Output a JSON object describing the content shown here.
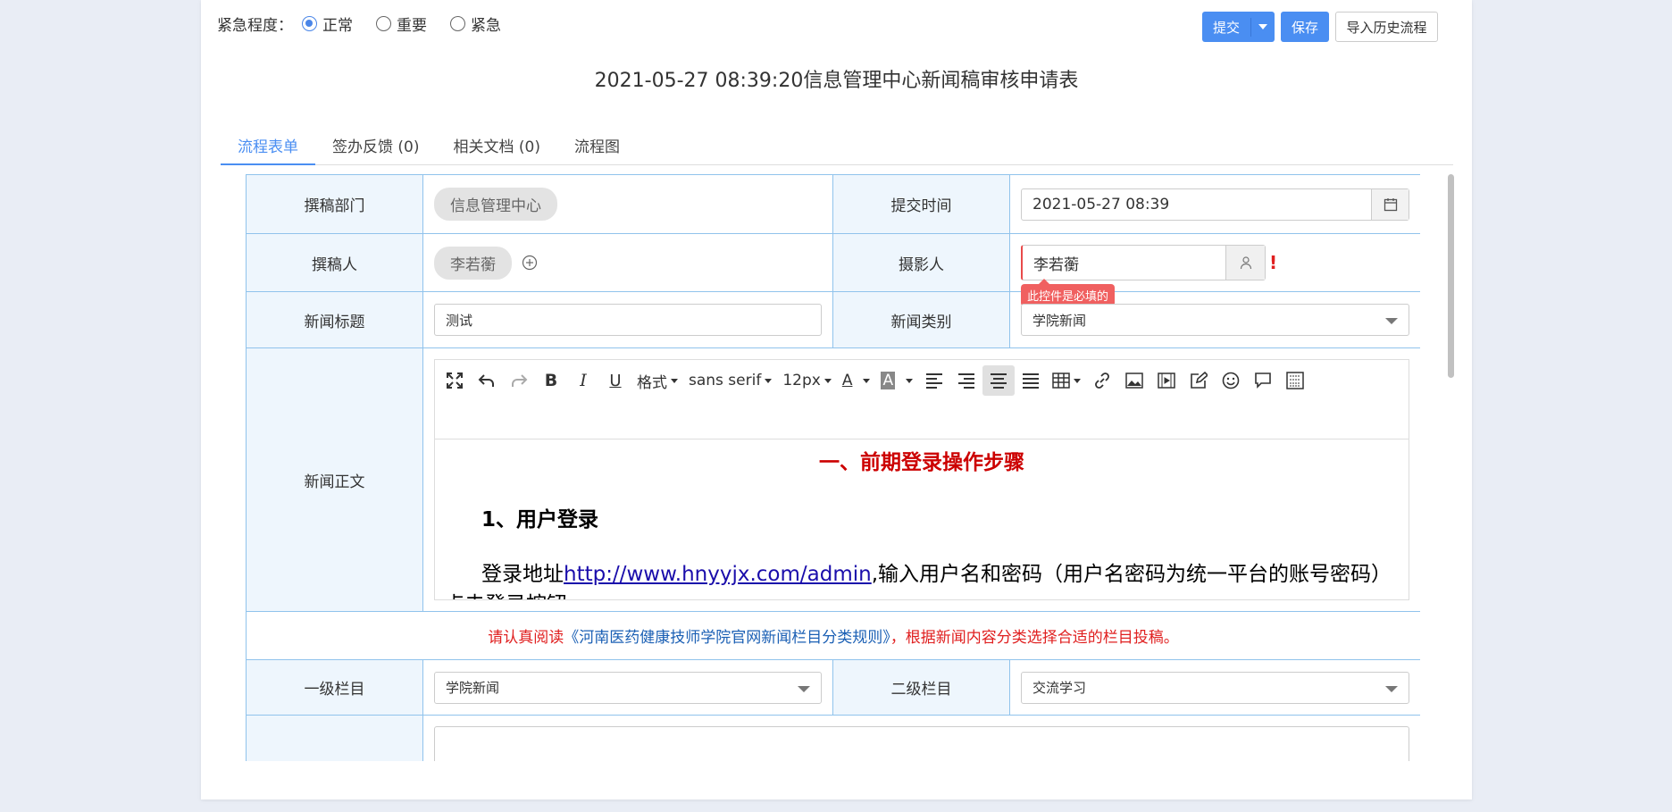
{
  "urgency": {
    "label": "紧急程度：",
    "options": [
      "正常",
      "重要",
      "紧急"
    ],
    "selected": "正常"
  },
  "buttons": {
    "submit": "提交",
    "save": "保存",
    "import": "导入历史流程"
  },
  "title": "2021-05-27 08:39:20信息管理中心新闻稿审核申请表",
  "tabs": [
    "流程表单",
    "签办反馈 (0)",
    "相关文档 (0)",
    "流程图"
  ],
  "form": {
    "dept_label": "撰稿部门",
    "dept_value": "信息管理中心",
    "submit_time_label": "提交时间",
    "submit_time_value": "2021-05-27 08:39",
    "author_label": "撰稿人",
    "author_value": "李若蘅",
    "photographer_label": "摄影人",
    "photographer_value": "李若蘅",
    "required_tip": "此控件是必填的",
    "news_title_label": "新闻标题",
    "news_title_value": "测试",
    "news_type_label": "新闻类别",
    "news_type_value": "学院新闻",
    "body_label": "新闻正文",
    "level1_label": "一级栏目",
    "level1_value": "学院新闻",
    "level2_label": "二级栏目",
    "level2_value": "交流学习"
  },
  "editor": {
    "toolbar": {
      "format": "格式",
      "font": "sans serif",
      "size": "12px"
    },
    "heading": "一、前期登录操作步骤",
    "sub_heading": "1、用户登录",
    "para_prefix": "登录地址",
    "link": "http://www.hnyyjx.com/admin",
    "para_suffix": ",输入用户名和密码（用户名密码为统一平台的账号密码）点击登录按钮。"
  },
  "notice": {
    "prefix": "请认真阅读",
    "link": "《河南医药健康技师学院官网新闻栏目分类规则》",
    "suffix": "，根据新闻内容分类选择合适的栏目投稿。"
  },
  "colors": {
    "primary": "#4a8ef2",
    "border": "#90c3ec",
    "required": "#e02020"
  }
}
